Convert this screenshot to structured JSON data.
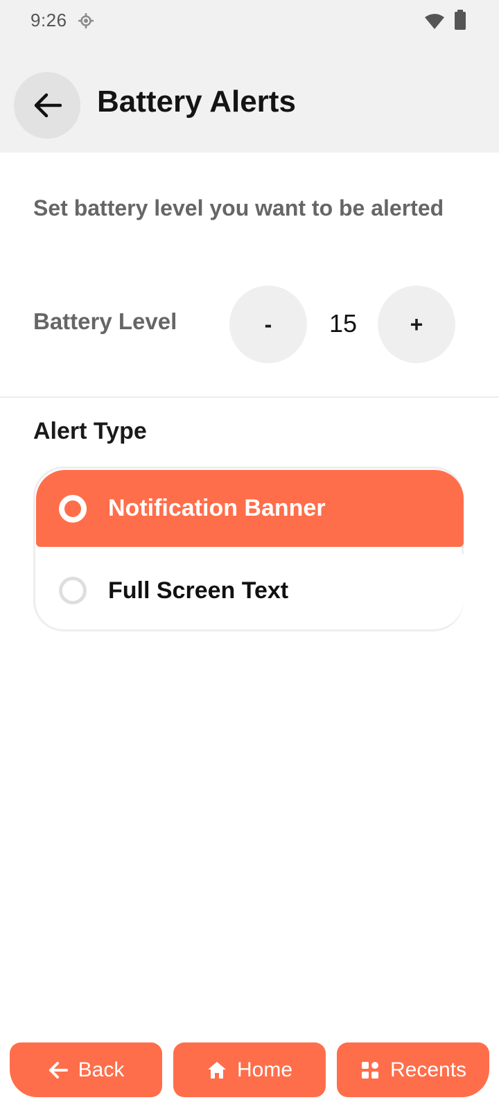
{
  "status_bar": {
    "time": "9:26",
    "icons": [
      "location-icon",
      "wifi-icon",
      "battery-icon"
    ]
  },
  "header": {
    "back_icon": "arrow-left-icon",
    "title": "Battery Alerts"
  },
  "battery_section": {
    "description": "Set battery level you want to be alerted",
    "level_label": "Battery Level",
    "decrement_label": "-",
    "increment_label": "+",
    "level_value": "15"
  },
  "alert_type": {
    "title": "Alert Type",
    "options": [
      {
        "label": "Notification Banner",
        "selected": true
      },
      {
        "label": "Full Screen Text",
        "selected": false
      }
    ]
  },
  "bottom_nav": {
    "back_label": "Back",
    "home_label": "Home",
    "recents_label": "Recents",
    "back_icon": "arrow-left-icon",
    "home_icon": "home-icon",
    "recents_icon": "grid-icon"
  },
  "colors": {
    "accent": "#ff6e4a",
    "header_bg": "#f1f1f1",
    "muted_text": "#666666"
  }
}
